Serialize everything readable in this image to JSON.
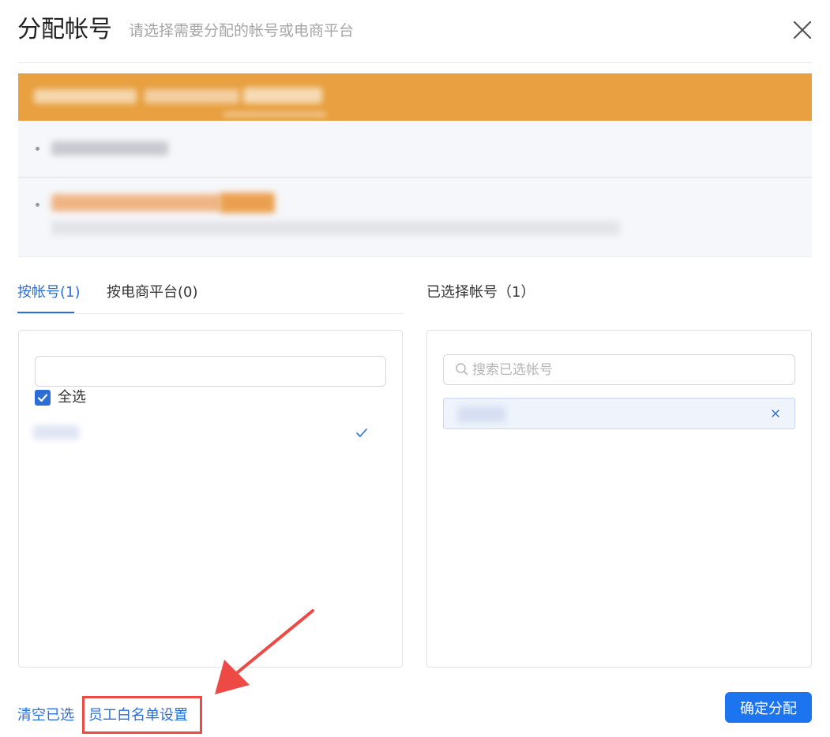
{
  "dialog": {
    "title": "分配帐号",
    "subtitle": "请选择需要分配的帐号或电商平台"
  },
  "tabs": [
    {
      "label": "按帐号(1)",
      "active": true
    },
    {
      "label": "按电商平台(0)",
      "active": false
    }
  ],
  "left_panel": {
    "search_value": "",
    "select_all_label": "全选",
    "select_all_checked": true
  },
  "right_panel": {
    "title": "已选择帐号（1）",
    "search_placeholder": "搜索已选帐号"
  },
  "footer": {
    "clear_label": "清空已选",
    "whitelist_label": "员工白名单设置",
    "confirm_label": "确定分配"
  },
  "colors": {
    "accent": "#2b6fd6",
    "primary_button": "#1c74ee",
    "banner": "#e8a040",
    "annotation": "#ee4a45"
  }
}
